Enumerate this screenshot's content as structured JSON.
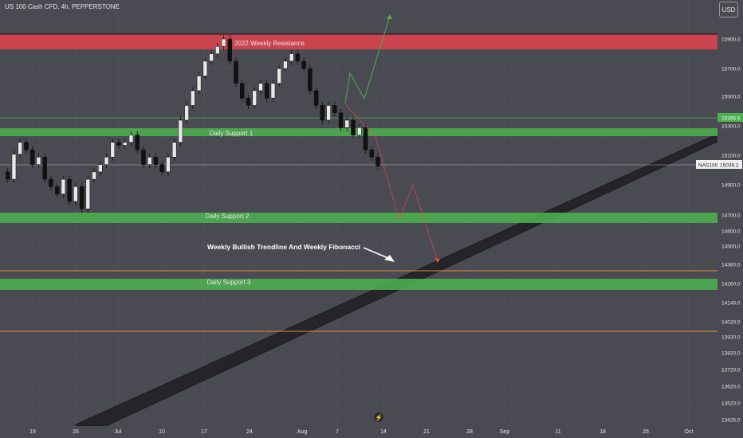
{
  "header": {
    "title": "US 100 Cash CFD, 4h, PEPPERSTONE",
    "currency_button": "USD"
  },
  "chart_data": {
    "type": "candlestick",
    "symbol": "NAS100",
    "last_price": "15039.2",
    "marker_price": "15355.5",
    "y_ticks": [
      "15900.0",
      "15700.0",
      "15500.0",
      "15300.0",
      "15100.0",
      "14900.0",
      "14700.0",
      "14600.0",
      "14500.0",
      "14380.0",
      "14260.0",
      "14140.0",
      "14020.0",
      "13920.0",
      "13820.0",
      "13720.0",
      "13620.0",
      "13520.0",
      "13425.0"
    ],
    "x_ticks": [
      "19",
      "26",
      "Jul",
      "10",
      "17",
      "24",
      "Aug",
      "7",
      "14",
      "21",
      "28",
      "Sep",
      "11",
      "18",
      "25",
      "Oct"
    ],
    "zones": [
      {
        "label": "2022 Weekly Resistance",
        "color": "#d9434e"
      },
      {
        "label": "Daily Support 1",
        "color": "#4caf50"
      },
      {
        "label": "Daily Support 2",
        "color": "#4caf50"
      },
      {
        "label": "Daily Support 3",
        "color": "#4caf50"
      }
    ],
    "annotation": "Weekly Bullish Trendline And Weekly Fibonacci",
    "colors": {
      "background": "#4a4a52",
      "resistance": "#d9434e",
      "support": "#4caf50",
      "orange_line": "#e0913a",
      "bull_path": "#4caf50",
      "bear_path": "#e04b4b"
    },
    "price_series": [
      15000,
      14950,
      15120,
      15200,
      15150,
      15050,
      15100,
      14950,
      14900,
      14850,
      14950,
      14800,
      14900,
      14750,
      14950,
      15000,
      15050,
      15100,
      15200,
      15180,
      15200,
      15250,
      15150,
      15050,
      15100,
      15050,
      15000,
      15100,
      15200,
      15350,
      15450,
      15550,
      15650,
      15750,
      15800,
      15850,
      15900,
      15750,
      15600,
      15500,
      15450,
      15550,
      15600,
      15500,
      15600,
      15700,
      15750,
      15800,
      15750,
      15700,
      15550,
      15450,
      15350,
      15450,
      15400,
      15300,
      15350,
      15250,
      15300,
      15150,
      15100,
      15039
    ]
  },
  "logo_glyph": "⚡"
}
